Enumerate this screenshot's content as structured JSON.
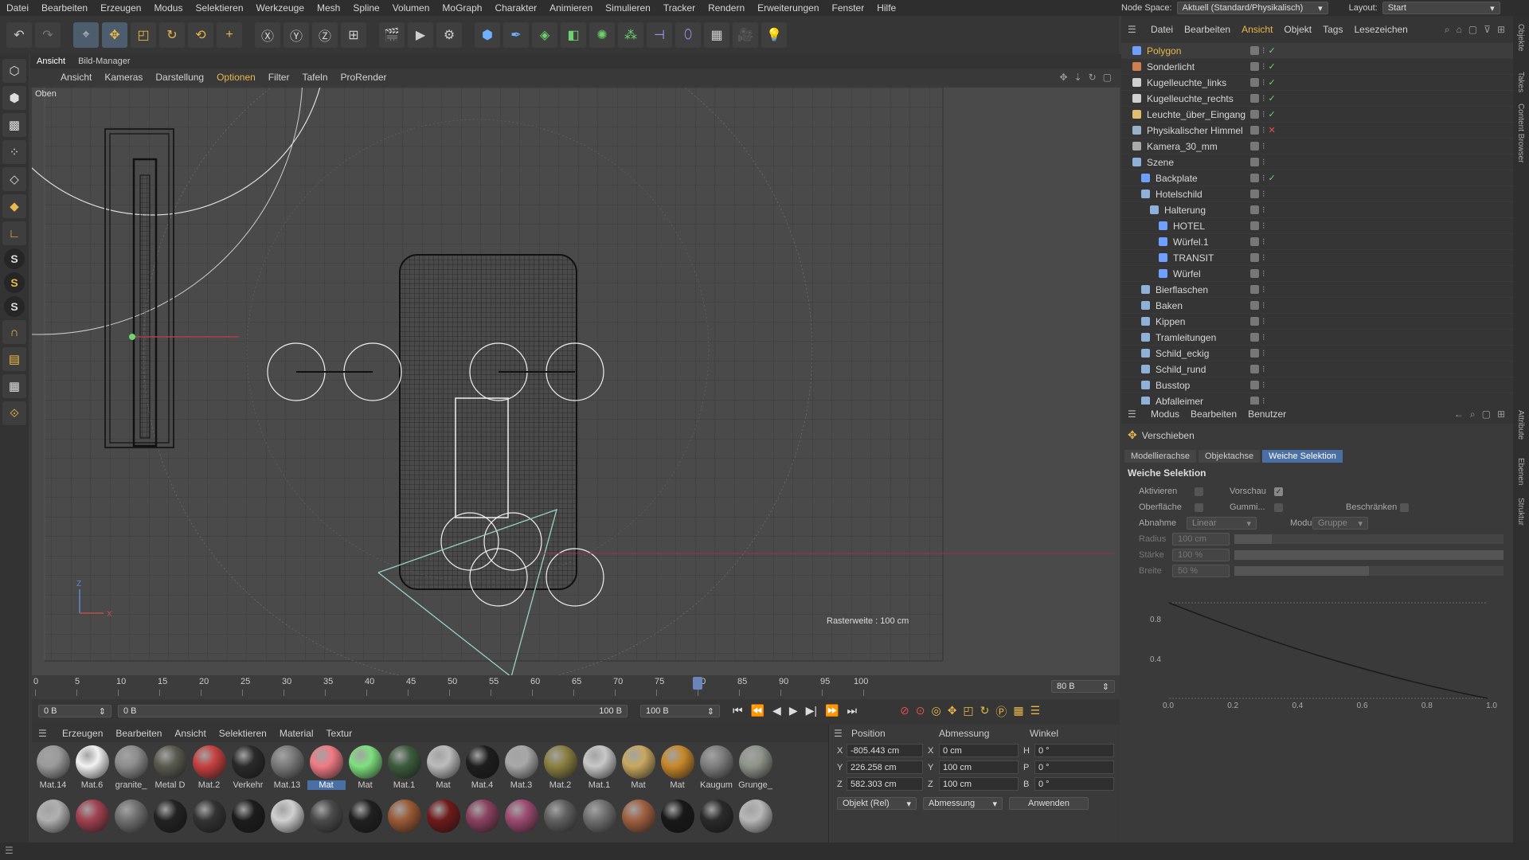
{
  "menubar": {
    "items": [
      "Datei",
      "Bearbeiten",
      "Erzeugen",
      "Modus",
      "Selektieren",
      "Werkzeuge",
      "Mesh",
      "Spline",
      "Volumen",
      "MoGraph",
      "Charakter",
      "Animieren",
      "Simulieren",
      "Tracker",
      "Rendern",
      "Erweiterungen",
      "Fenster",
      "Hilfe"
    ],
    "node_space_label": "Node Space:",
    "node_space_value": "Aktuell (Standard/Physikalisch)",
    "layout_label": "Layout:",
    "layout_value": "Start"
  },
  "viewport": {
    "tabs": [
      "Ansicht",
      "Bild-Manager"
    ],
    "menu": [
      "Ansicht",
      "Kameras",
      "Darstellung",
      "Optionen",
      "Filter",
      "Tafeln",
      "ProRender"
    ],
    "view_name": "Oben",
    "grid_info": "Rasterweite : 100 cm"
  },
  "timeline": {
    "ticks": [
      "0",
      "5",
      "10",
      "15",
      "20",
      "25",
      "30",
      "35",
      "40",
      "45",
      "50",
      "55",
      "60",
      "65",
      "70",
      "75",
      "80",
      "85",
      "90",
      "95",
      "100"
    ],
    "current_frame": "80 B",
    "playhead_fraction": 0.8
  },
  "transport": {
    "start": "0 B",
    "range_start": "0 B",
    "range_end": "100 B",
    "end": "100 B"
  },
  "materials": {
    "menu": [
      "Erzeugen",
      "Bearbeiten",
      "Ansicht",
      "Selektieren",
      "Material",
      "Textur"
    ],
    "row1": [
      {
        "name": "Mat.14",
        "color": "#9a9a9a"
      },
      {
        "name": "Mat.6",
        "color": "#f2f2f2"
      },
      {
        "name": "granite_",
        "color": "#8d8d8d"
      },
      {
        "name": "Metal D",
        "color": "#5a5a50"
      },
      {
        "name": "Mat.2",
        "color": "#c84040"
      },
      {
        "name": "Verkehr",
        "color": "#2a2a2a"
      },
      {
        "name": "Mat.13",
        "color": "#7a7a7a"
      },
      {
        "name": "Mat",
        "color": "#f07a85"
      },
      {
        "name": "Mat",
        "color": "#7fe07f"
      },
      {
        "name": "Mat.1",
        "color": "#3d5c3d"
      },
      {
        "name": "Mat",
        "color": "#bcbcbc"
      },
      {
        "name": "Mat.4",
        "color": "#1e1e1e"
      },
      {
        "name": "Mat.3",
        "color": "#a8a8a8"
      },
      {
        "name": "Mat.2",
        "color": "#8a8040"
      },
      {
        "name": "Mat.1",
        "color": "#c8c8c8"
      },
      {
        "name": "Mat",
        "color": "#c9a860"
      },
      {
        "name": "Mat",
        "color": "#c8882a"
      },
      {
        "name": "Kaugum",
        "color": "#7e7e7e"
      },
      {
        "name": "Grunge_",
        "color": "#8e948a"
      }
    ],
    "row2_colors": [
      "#b0b0b0",
      "#a04050",
      "#707070",
      "#222222",
      "#333333",
      "#1c1c1c",
      "#d0d0d0",
      "#4a4a4a",
      "#202020",
      "#9a5a35",
      "#701a1a",
      "#8a4060",
      "#9c4a70",
      "#606060",
      "#707070",
      "#a06040",
      "#181818",
      "#2a2a2a",
      "#b8b8b8"
    ]
  },
  "coords": {
    "headers": [
      "Position",
      "Abmessung",
      "Winkel"
    ],
    "rows": [
      {
        "axis": "X",
        "pos": "-805.443 cm",
        "dim_axis": "X",
        "dim": "0 cm",
        "ang_axis": "H",
        "ang": "0 °"
      },
      {
        "axis": "Y",
        "pos": "226.258 cm",
        "dim_axis": "Y",
        "dim": "100 cm",
        "ang_axis": "P",
        "ang": "0 °"
      },
      {
        "axis": "Z",
        "pos": "582.303 cm",
        "dim_axis": "Z",
        "dim": "100 cm",
        "ang_axis": "B",
        "ang": "0 °"
      }
    ],
    "mode": "Objekt (Rel)",
    "size_mode": "Abmessung",
    "apply": "Anwenden"
  },
  "objects": {
    "menu": [
      "Datei",
      "Bearbeiten",
      "Ansicht",
      "Objekt",
      "Tags",
      "Lesezeichen"
    ],
    "items": [
      {
        "name": "Polygon",
        "indent": 0,
        "color": "#6fa0ff",
        "hl": true,
        "tag": "tick"
      },
      {
        "name": "Sonderlicht",
        "indent": 0,
        "color": "#d08050",
        "tag": "tick"
      },
      {
        "name": "Kugelleuchte_links",
        "indent": 0,
        "color": "#d0d0d0",
        "tag": "tick"
      },
      {
        "name": "Kugelleuchte_rechts",
        "indent": 0,
        "color": "#d0d0d0",
        "tag": "tick"
      },
      {
        "name": "Leuchte_über_Eingang",
        "indent": 0,
        "color": "#e0c070",
        "tag": "tick"
      },
      {
        "name": "Physikalischer Himmel",
        "indent": 0,
        "color": "#9ab0c8",
        "tag": "x"
      },
      {
        "name": "Kamera_30_mm",
        "indent": 0,
        "color": "#aaaaaa",
        "tag": "none"
      },
      {
        "name": "Szene",
        "indent": 0,
        "color": "#8fb0d8",
        "tag": "none"
      },
      {
        "name": "Backplate",
        "indent": 1,
        "color": "#6fa0ff",
        "tag": "tick"
      },
      {
        "name": "Hotelschild",
        "indent": 1,
        "color": "#8fb0d8",
        "tag": "none"
      },
      {
        "name": "Halterung",
        "indent": 2,
        "color": "#8fb0d8",
        "tag": "none"
      },
      {
        "name": "HOTEL",
        "indent": 3,
        "color": "#6fa0ff",
        "tag": "none"
      },
      {
        "name": "Würfel.1",
        "indent": 3,
        "color": "#6fa0ff",
        "tag": "none"
      },
      {
        "name": "TRANSIT",
        "indent": 3,
        "color": "#6fa0ff",
        "tag": "none"
      },
      {
        "name": "Würfel",
        "indent": 3,
        "color": "#6fa0ff",
        "tag": "none"
      },
      {
        "name": "Bierflaschen",
        "indent": 1,
        "color": "#8fb0d8",
        "tag": "none"
      },
      {
        "name": "Baken",
        "indent": 1,
        "color": "#8fb0d8",
        "tag": "none"
      },
      {
        "name": "Kippen",
        "indent": 1,
        "color": "#8fb0d8",
        "tag": "none"
      },
      {
        "name": "Tramleitungen",
        "indent": 1,
        "color": "#8fb0d8",
        "tag": "none"
      },
      {
        "name": "Schild_eckig",
        "indent": 1,
        "color": "#8fb0d8",
        "tag": "none"
      },
      {
        "name": "Schild_rund",
        "indent": 1,
        "color": "#8fb0d8",
        "tag": "none"
      },
      {
        "name": "Busstop",
        "indent": 1,
        "color": "#8fb0d8",
        "tag": "none"
      },
      {
        "name": "Abfalleimer",
        "indent": 1,
        "color": "#8fb0d8",
        "tag": "none"
      }
    ]
  },
  "attributes": {
    "menu": [
      "Modus",
      "Bearbeiten",
      "Benutzer"
    ],
    "tool": "Verschieben",
    "tabs": [
      "Modellierachse",
      "Objektachse",
      "Weiche Selektion"
    ],
    "section": "Weiche Selektion",
    "aktivieren": "Aktivieren",
    "vorschau": "Vorschau",
    "oberflaeche": "Oberfläche",
    "gummi": "Gummi...",
    "beschraenken": "Beschränken",
    "abnahme_label": "Abnahme",
    "abnahme_value": "Linear",
    "modus_label": "Modus",
    "modus_value": "Gruppe",
    "radius_label": "Radius",
    "radius_value": "100 cm",
    "staerke_label": "Stärke",
    "staerke_value": "100 %",
    "breite_label": "Breite",
    "breite_value": "50 %",
    "curve_y_ticks": [
      "0.8",
      "0.4"
    ],
    "curve_x_ticks": [
      "0.0",
      "0.2",
      "0.4",
      "0.6",
      "0.8",
      "1.0"
    ]
  },
  "right_tabs": [
    "Objekte",
    "Takes",
    "Content Browser",
    "Attribute",
    "Ebenen",
    "Struktur"
  ],
  "colors": {
    "accent": "#e8b84a",
    "selection": "#4a6fa5"
  }
}
